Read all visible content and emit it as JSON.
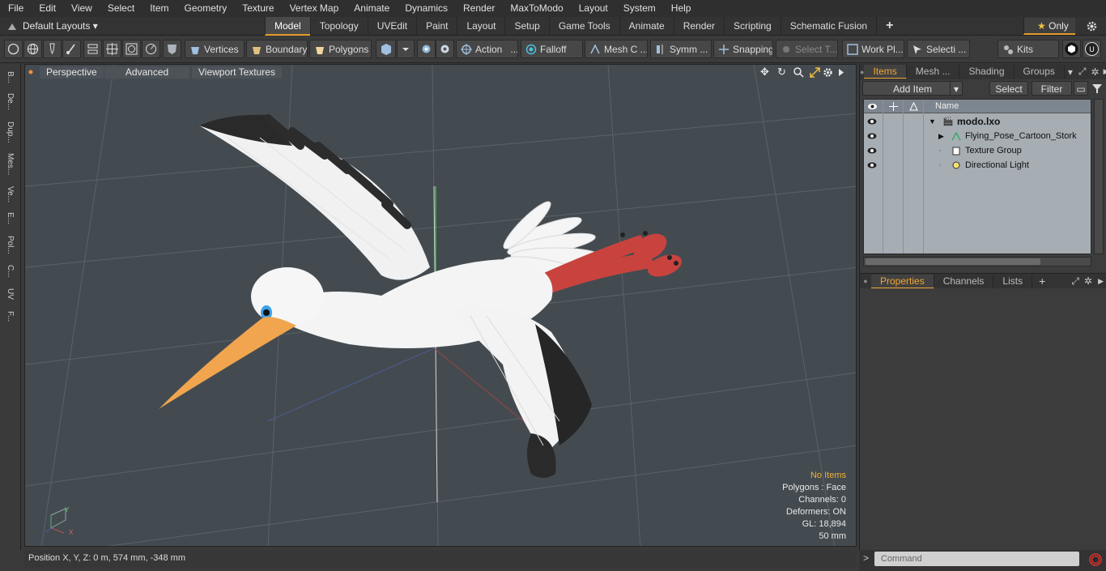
{
  "menubar": {
    "items": [
      "File",
      "Edit",
      "View",
      "Select",
      "Item",
      "Geometry",
      "Texture",
      "Vertex Map",
      "Animate",
      "Dynamics",
      "Render",
      "MaxToModo",
      "Layout",
      "System",
      "Help"
    ]
  },
  "modebar": {
    "layout_selector": "Default Layouts",
    "tabs": [
      "Model",
      "Topology",
      "UVEdit",
      "Paint",
      "Layout",
      "Setup",
      "Game Tools",
      "Animate",
      "Render",
      "Scripting",
      "Schematic Fusion"
    ],
    "active_tab": "Model",
    "only_label": "Only"
  },
  "toolbar": {
    "vertices": "Vertices",
    "boundary": "Boundary",
    "polygons": "Polygons",
    "action": "Action",
    "falloff": "Falloff",
    "mesh_c": "Mesh C ...",
    "symm": "Symm ...",
    "snapping": "Snapping",
    "select_t": "Select T...",
    "work_pl": "Work Pl...",
    "selecti": "Selecti ...",
    "kits": "Kits"
  },
  "leftstrip": {
    "tabs": [
      "B...",
      "De...",
      "Dup...",
      "Mes...",
      "Ve...",
      "E...",
      "Pol...",
      "C...",
      "UV",
      "F..."
    ]
  },
  "viewport": {
    "perspective": "Perspective",
    "advanced": "Advanced",
    "viewport_textures": "Viewport Textures",
    "hud": {
      "no_items": "No Items",
      "polygons": "Polygons : Face",
      "channels": "Channels: 0",
      "deformers": "Deformers: ON",
      "gl": "GL: 18,894",
      "distance": "50 mm"
    }
  },
  "statusbar": {
    "position": "Position X, Y, Z:   0 m, 574 mm, -348 mm"
  },
  "items_panel": {
    "tabs": [
      "Items",
      "Mesh ...",
      "Shading",
      "Groups"
    ],
    "active_tab": "Items",
    "add_item": "Add Item",
    "select": "Select",
    "filter": "Filter",
    "name_header": "Name",
    "rows": [
      {
        "label": "modo.lxo"
      },
      {
        "label": "Flying_Pose_Cartoon_Stork"
      },
      {
        "label": "Texture Group"
      },
      {
        "label": "Directional Light"
      }
    ]
  },
  "properties_panel": {
    "tabs": [
      "Properties",
      "Channels",
      "Lists"
    ],
    "active_tab": "Properties"
  },
  "command": {
    "placeholder": "Command"
  },
  "colors": {
    "accent": "#e39b2b",
    "viewport_bg": "#444b50",
    "tree_bg": "#a6adb3"
  }
}
